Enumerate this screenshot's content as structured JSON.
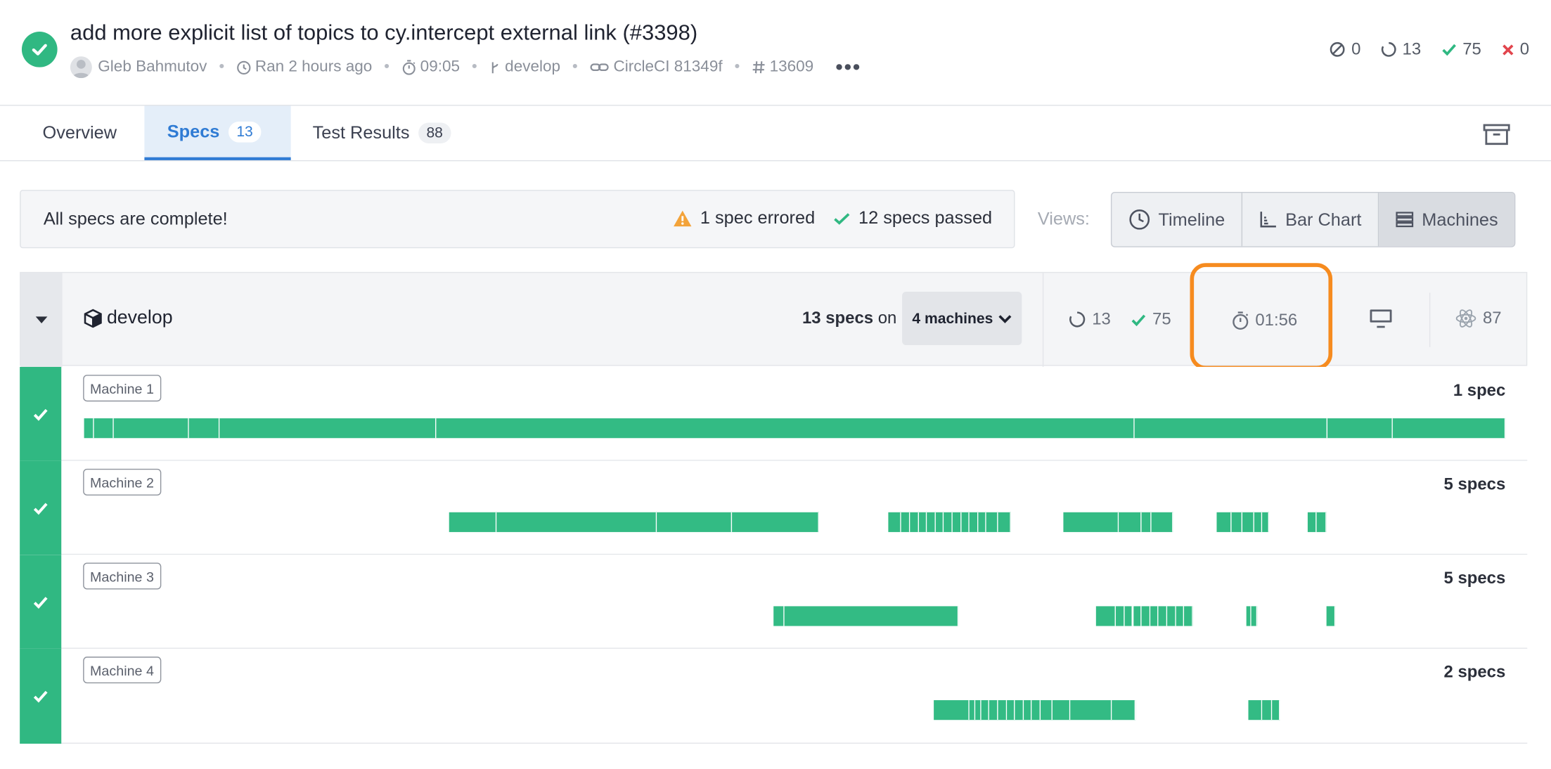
{
  "run": {
    "title": "add more explicit list of topics to cy.intercept external link (#3398)",
    "author": "Gleb Bahmutov",
    "ran": "Ran 2 hours ago",
    "duration": "09:05",
    "branch": "develop",
    "ci": "CircleCI 81349f",
    "number": "13609",
    "more": "•••",
    "counts": {
      "skipped": "0",
      "pending": "13",
      "passed": "75",
      "failed": "0"
    }
  },
  "tabs": [
    {
      "label": "Overview",
      "count": ""
    },
    {
      "label": "Specs",
      "count": "13"
    },
    {
      "label": "Test Results",
      "count": "88"
    }
  ],
  "summary": {
    "message": "All specs are complete!",
    "errored": "1 spec errored",
    "passed": "12 specs passed"
  },
  "views": {
    "label": "Views:",
    "options": [
      "Timeline",
      "Bar Chart",
      "Machines"
    ],
    "selected": "Machines"
  },
  "group": {
    "name": "develop",
    "specs": "13 specs",
    "on": "on",
    "machines": "4 machines",
    "pending": "13",
    "passed": "75",
    "duration": "01:56",
    "electron": "87"
  },
  "machines": [
    {
      "label": "Machine 1",
      "count": "1 spec",
      "segments": [
        [
          0.0,
          0.7
        ],
        [
          0.7,
          2.1
        ],
        [
          2.1,
          7.4
        ],
        [
          7.4,
          9.5
        ],
        [
          9.5,
          24.8
        ],
        [
          24.8,
          73.9
        ],
        [
          73.9,
          87.5
        ],
        [
          87.5,
          92.1
        ],
        [
          92.1,
          100
        ]
      ]
    },
    {
      "label": "Machine 2",
      "count": "5 specs",
      "segments": [
        [
          25.7,
          29.0
        ],
        [
          29.0,
          40.3
        ],
        [
          40.3,
          45.6
        ],
        [
          45.6,
          51.7
        ],
        [
          56.6,
          57.5
        ],
        [
          57.5,
          58.1
        ],
        [
          58.1,
          58.7
        ],
        [
          58.7,
          59.3
        ],
        [
          59.3,
          59.9
        ],
        [
          59.9,
          60.5
        ],
        [
          60.5,
          61.1
        ],
        [
          61.1,
          61.7
        ],
        [
          61.7,
          62.3
        ],
        [
          62.3,
          62.9
        ],
        [
          62.9,
          63.5
        ],
        [
          63.5,
          64.3
        ],
        [
          64.3,
          65.2
        ],
        [
          68.9,
          72.8
        ],
        [
          72.8,
          74.4
        ],
        [
          74.4,
          75.1
        ],
        [
          75.1,
          76.6
        ],
        [
          79.7,
          80.7
        ],
        [
          80.7,
          81.5
        ],
        [
          81.5,
          82.3
        ],
        [
          82.3,
          82.9
        ],
        [
          82.9,
          83.4
        ],
        [
          86.1,
          86.7
        ],
        [
          86.7,
          87.4
        ]
      ]
    },
    {
      "label": "Machine 3",
      "count": "5 specs",
      "segments": [
        [
          48.5,
          49.3
        ],
        [
          49.3,
          61.5
        ],
        [
          71.2,
          72.6
        ],
        [
          72.6,
          73.2
        ],
        [
          73.2,
          73.8
        ],
        [
          73.8,
          74.4
        ],
        [
          74.4,
          75.0
        ],
        [
          75.0,
          75.6
        ],
        [
          75.6,
          76.2
        ],
        [
          76.2,
          76.8
        ],
        [
          76.8,
          77.4
        ],
        [
          77.4,
          78.0
        ],
        [
          81.8,
          82.1
        ],
        [
          82.1,
          82.5
        ],
        [
          87.4,
          88.0
        ]
      ]
    },
    {
      "label": "Machine 4",
      "count": "2 specs",
      "segments": [
        [
          59.8,
          62.3
        ],
        [
          62.3,
          62.7
        ],
        [
          62.7,
          63.1
        ],
        [
          63.1,
          63.7
        ],
        [
          63.7,
          64.3
        ],
        [
          64.3,
          64.9
        ],
        [
          64.9,
          65.5
        ],
        [
          65.5,
          66.1
        ],
        [
          66.1,
          66.7
        ],
        [
          66.7,
          67.3
        ],
        [
          67.3,
          68.1
        ],
        [
          68.1,
          69.4
        ],
        [
          69.4,
          72.3
        ],
        [
          72.3,
          74.0
        ],
        [
          81.9,
          82.9
        ],
        [
          82.9,
          83.6
        ],
        [
          83.6,
          84.1
        ]
      ]
    }
  ],
  "colors": {
    "passed": "#33bb84",
    "accent": "#2f7bd4",
    "highlight": "#f68b1f",
    "warning": "#f3a33a",
    "failed": "#e2454d"
  }
}
